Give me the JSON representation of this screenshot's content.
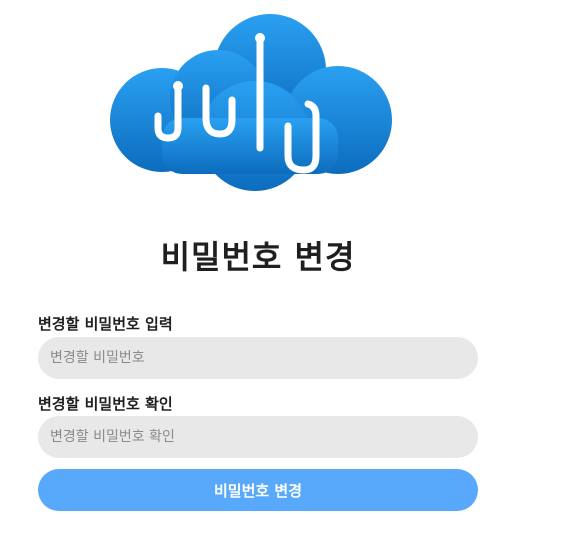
{
  "logo": {
    "icon": "cloud-logo-icon",
    "color_top": "#2a9bf0",
    "color_bottom": "#0f6fc0"
  },
  "title": "비밀번호 변경",
  "new_password": {
    "label": "변경할 비밀번호 입력",
    "placeholder": "변경할 비밀번호",
    "value": ""
  },
  "confirm_password": {
    "label": "변경할 비밀번호 확인",
    "placeholder": "변경할 비밀번호 확인",
    "value": ""
  },
  "submit_label": "비밀번호 변경",
  "colors": {
    "button": "#58a8fb",
    "field_bg": "#e8e8e8",
    "text": "#1f1f1f"
  }
}
